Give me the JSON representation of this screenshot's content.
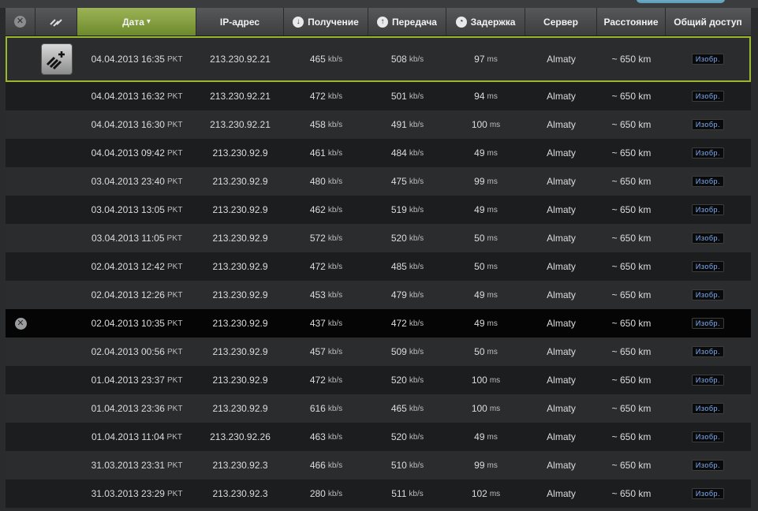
{
  "header": {
    "date": "Дата",
    "sort_arrow": "▾",
    "ip": "IP-адрес",
    "download": "Получение",
    "upload": "Передача",
    "latency": "Задержка",
    "server": "Сервер",
    "distance": "Расстояние",
    "share": "Общий доступ",
    "close_glyph": "✕"
  },
  "unit_speed": "kb/s",
  "unit_latency": "ms",
  "rows": [
    {
      "date": "04.04.2013 16:35",
      "tz": "PKT",
      "ip": "213.230.92.21",
      "down": "465",
      "up": "508",
      "ping": "97",
      "server": "Almaty",
      "dist": "~ 650 km",
      "share": "Изобр."
    },
    {
      "date": "04.04.2013 16:32",
      "tz": "PKT",
      "ip": "213.230.92.21",
      "down": "472",
      "up": "501",
      "ping": "94",
      "server": "Almaty",
      "dist": "~ 650 km",
      "share": "Изобр."
    },
    {
      "date": "04.04.2013 16:30",
      "tz": "PKT",
      "ip": "213.230.92.21",
      "down": "458",
      "up": "491",
      "ping": "100",
      "server": "Almaty",
      "dist": "~ 650 km",
      "share": "Изобр."
    },
    {
      "date": "04.04.2013 09:42",
      "tz": "PKT",
      "ip": "213.230.92.9",
      "down": "461",
      "up": "484",
      "ping": "49",
      "server": "Almaty",
      "dist": "~ 650 km",
      "share": "Изобр."
    },
    {
      "date": "03.04.2013 23:40",
      "tz": "PKT",
      "ip": "213.230.92.9",
      "down": "480",
      "up": "475",
      "ping": "99",
      "server": "Almaty",
      "dist": "~ 650 km",
      "share": "Изобр."
    },
    {
      "date": "03.04.2013 13:05",
      "tz": "PKT",
      "ip": "213.230.92.9",
      "down": "462",
      "up": "519",
      "ping": "49",
      "server": "Almaty",
      "dist": "~ 650 km",
      "share": "Изобр."
    },
    {
      "date": "03.04.2013 11:05",
      "tz": "PKT",
      "ip": "213.230.92.9",
      "down": "572",
      "up": "520",
      "ping": "50",
      "server": "Almaty",
      "dist": "~ 650 km",
      "share": "Изобр."
    },
    {
      "date": "02.04.2013 12:42",
      "tz": "PKT",
      "ip": "213.230.92.9",
      "down": "472",
      "up": "485",
      "ping": "50",
      "server": "Almaty",
      "dist": "~ 650 km",
      "share": "Изобр."
    },
    {
      "date": "02.04.2013 12:26",
      "tz": "PKT",
      "ip": "213.230.92.9",
      "down": "453",
      "up": "479",
      "ping": "49",
      "server": "Almaty",
      "dist": "~ 650 km",
      "share": "Изобр."
    },
    {
      "date": "02.04.2013 10:35",
      "tz": "PKT",
      "ip": "213.230.92.9",
      "down": "437",
      "up": "472",
      "ping": "49",
      "server": "Almaty",
      "dist": "~ 650 km",
      "share": "Изобр."
    },
    {
      "date": "02.04.2013 00:56",
      "tz": "PKT",
      "ip": "213.230.92.9",
      "down": "457",
      "up": "509",
      "ping": "50",
      "server": "Almaty",
      "dist": "~ 650 km",
      "share": "Изобр."
    },
    {
      "date": "01.04.2013 23:37",
      "tz": "PKT",
      "ip": "213.230.92.9",
      "down": "472",
      "up": "520",
      "ping": "100",
      "server": "Almaty",
      "dist": "~ 650 km",
      "share": "Изобр."
    },
    {
      "date": "01.04.2013 23:36",
      "tz": "PKT",
      "ip": "213.230.92.9",
      "down": "616",
      "up": "465",
      "ping": "100",
      "server": "Almaty",
      "dist": "~ 650 km",
      "share": "Изобр."
    },
    {
      "date": "01.04.2013 11:04",
      "tz": "PKT",
      "ip": "213.230.92.26",
      "down": "463",
      "up": "520",
      "ping": "49",
      "server": "Almaty",
      "dist": "~ 650 km",
      "share": "Изобр."
    },
    {
      "date": "31.03.2013 23:31",
      "tz": "PKT",
      "ip": "213.230.92.3",
      "down": "466",
      "up": "510",
      "ping": "99",
      "server": "Almaty",
      "dist": "~ 650 km",
      "share": "Изобр."
    },
    {
      "date": "31.03.2013 23:29",
      "tz": "PKT",
      "ip": "213.230.92.3",
      "down": "280",
      "up": "511",
      "ping": "102",
      "server": "Almaty",
      "dist": "~ 650 km",
      "share": "Изобр."
    }
  ],
  "colors": {
    "accent": "#9ab82e",
    "share_text": "#7fb2ff"
  }
}
